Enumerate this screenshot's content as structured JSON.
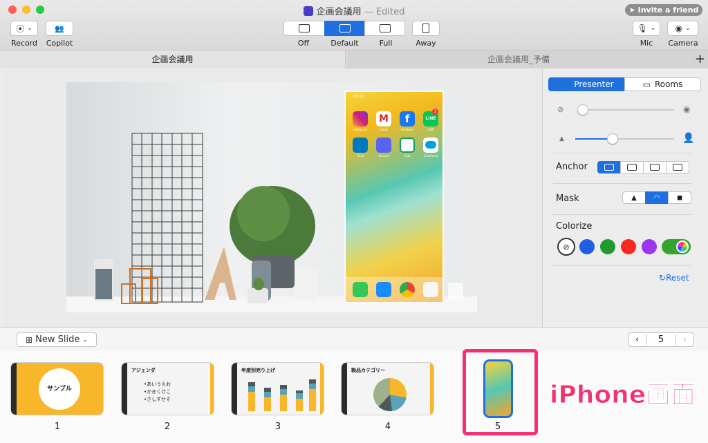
{
  "window": {
    "title": "企画会議用",
    "edited": "— Edited",
    "invite": "Invite a friend"
  },
  "toolbar": {
    "record": "Record",
    "copilot": "Copilot",
    "modes": [
      "Off",
      "Default",
      "Full",
      "Away"
    ],
    "active_mode": "Default",
    "mic": "Mic",
    "camera": "Camera"
  },
  "tabs": {
    "active": "企画会議用",
    "other": "企画会議用_予備",
    "add": "+"
  },
  "phone": {
    "time": "16:41",
    "apps_row1": [
      "Instagram",
      "Gmail",
      "Facebook",
      "LINE"
    ],
    "apps_row2": [
      "Trello",
      "Discord",
      "Chat",
      "Salesforce"
    ],
    "line_badge": "1"
  },
  "panel": {
    "presenter": "Presenter",
    "rooms": "Rooms",
    "anchor": "Anchor",
    "mask": "Mask",
    "colorize": "Colorize",
    "reset": "Reset",
    "opacity_level": 0.04,
    "size_level": 0.38,
    "swatches": [
      "#ffffff",
      "#1f5fe0",
      "#1e9a2f",
      "#f5281e",
      "#9b36f0"
    ],
    "toggle_color": "#34a42c",
    "accent": "#1f6fe0"
  },
  "bottom": {
    "new_slide": "New Slide",
    "page": "5"
  },
  "slides": [
    {
      "num": "1",
      "title": "サンプル"
    },
    {
      "num": "2",
      "title": "アジェンダ",
      "bullets": [
        "•あいうえお",
        "•かきくけこ",
        "•さしすせそ"
      ]
    },
    {
      "num": "3",
      "title": "年度別売り上げ"
    },
    {
      "num": "4",
      "title": "製品カテゴリー"
    },
    {
      "num": "5"
    }
  ],
  "annotation": "iPhone画面"
}
